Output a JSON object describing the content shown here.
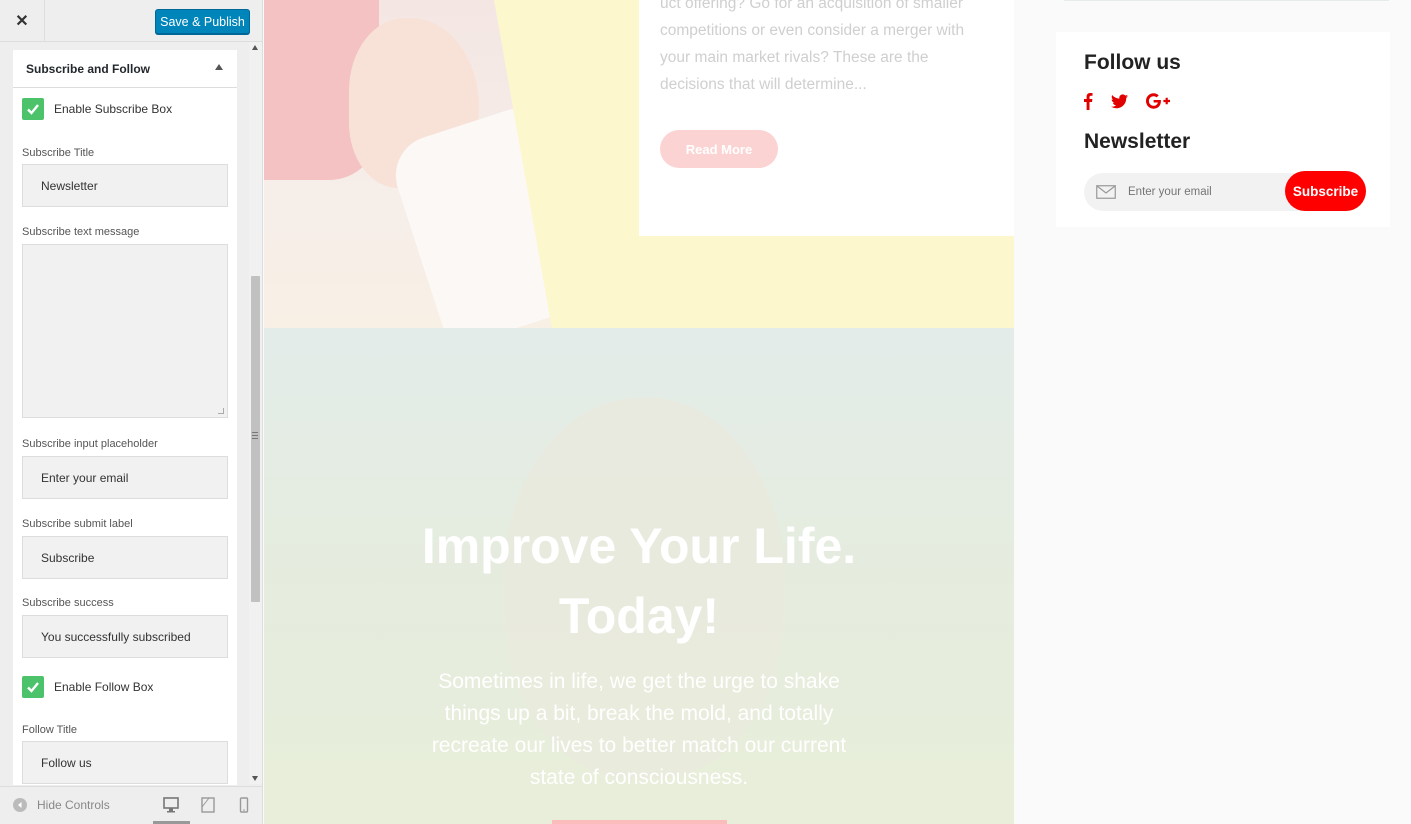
{
  "customizer": {
    "close_label": "✕",
    "save_publish_label": "Save & Publish",
    "section_title": "Subscribe and Follow",
    "enable_subscribe_label": "Enable Subscribe Box",
    "enable_subscribe_checked": true,
    "subscribe_title_label": "Subscribe Title",
    "subscribe_title_value": "Newsletter",
    "subscribe_text_label": "Subscribe text message",
    "subscribe_text_value": "",
    "subscribe_placeholder_label": "Subscribe input placeholder",
    "subscribe_placeholder_value": "Enter your email",
    "subscribe_submit_label": "Subscribe submit label",
    "subscribe_submit_value": "Subscribe",
    "subscribe_success_label": "Subscribe success",
    "subscribe_success_value": "You successfully subscribed",
    "enable_follow_label": "Enable Follow Box",
    "enable_follow_checked": true,
    "follow_title_label": "Follow Title",
    "follow_title_value": "Follow us",
    "footer": {
      "hide_controls_label": "Hide Controls",
      "devices": [
        "desktop-icon",
        "tablet-icon",
        "mobile-icon"
      ],
      "active_device": "desktop"
    }
  },
  "preview": {
    "post_excerpt": "uct offering? Go for an acquisition of smaller competitions or even consider a merger with your main market rivals? These are the decisions that will determine...",
    "read_more_label": "Read More",
    "hero_title": "Improve Your Life. Today!",
    "hero_text": "Sometimes in life, we get the urge to shake things up a bit, break the mold, and totally recreate our lives to better match our current state of consciousness.",
    "sidebar_widget": {
      "follow_title": "Follow us",
      "social_icons": [
        "facebook-icon",
        "twitter-icon",
        "google-plus-icon"
      ],
      "newsletter_title": "Newsletter",
      "email_placeholder": "Enter your email",
      "subscribe_label": "Subscribe"
    }
  },
  "colors": {
    "wp_blue": "#0085ba",
    "checkbox_green": "#4cc36a",
    "accent_red": "#ff0000"
  }
}
